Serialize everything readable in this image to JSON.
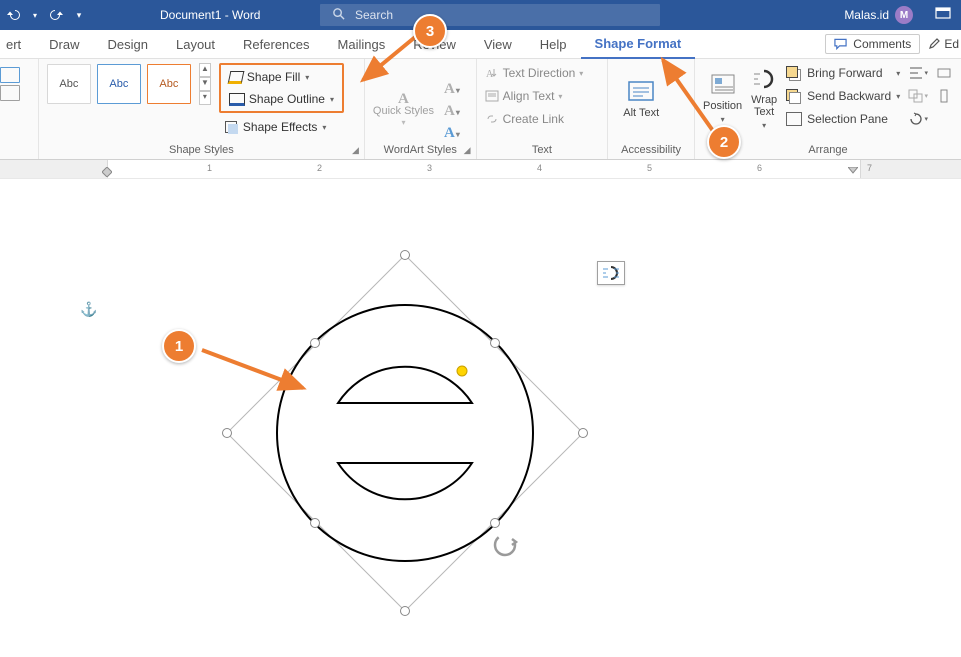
{
  "titlebar": {
    "doc_title": "Document1 - Word",
    "search_placeholder": "Search",
    "user_name": "Malas.id",
    "user_initial": "M"
  },
  "tabs": {
    "items": [
      "ert",
      "Draw",
      "Design",
      "Layout",
      "References",
      "Mailings",
      "Review",
      "View",
      "Help",
      "Shape Format"
    ],
    "active_index": 9,
    "comments": "Comments",
    "editing": "Ed"
  },
  "ribbon": {
    "shape_styles": {
      "label": "Shape Styles",
      "gallery": [
        "Abc",
        "Abc",
        "Abc"
      ],
      "fill": "Shape Fill",
      "outline": "Shape Outline",
      "effects": "Shape Effects"
    },
    "wordart": {
      "label": "WordArt Styles",
      "quick": "Quick Styles"
    },
    "text": {
      "label": "Text",
      "direction": "Text Direction",
      "align": "Align Text",
      "link": "Create Link"
    },
    "accessibility": {
      "label": "Accessibility",
      "alt": "Alt Text"
    },
    "arrange": {
      "label": "Arrange",
      "position": "Position",
      "wrap": "Wrap Text",
      "bring_forward": "Bring Forward",
      "send_backward": "Send Backward",
      "selection_pane": "Selection Pane"
    }
  },
  "ruler": {
    "numbers": [
      "1",
      "2",
      "3",
      "4",
      "5",
      "6",
      "7"
    ]
  },
  "annotations": {
    "a1": "1",
    "a2": "2",
    "a3": "3"
  }
}
